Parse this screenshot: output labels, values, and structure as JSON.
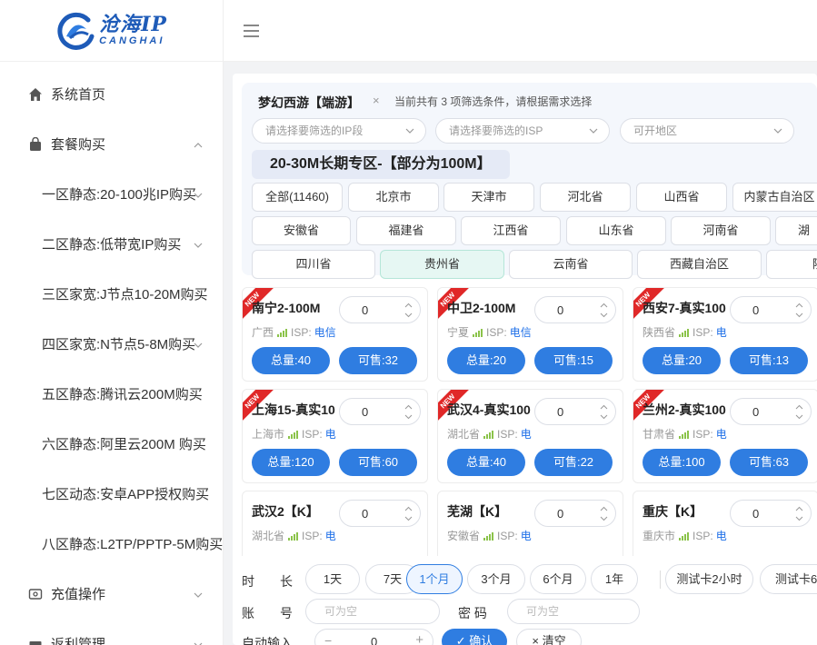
{
  "brand": {
    "name_cn": "沧海IP",
    "name_en": "CANGHAI"
  },
  "sidebar": {
    "items": [
      {
        "label": "系统首页",
        "icon": "home-icon"
      },
      {
        "label": "套餐购买",
        "icon": "bag-icon",
        "expanded": true
      },
      {
        "label": "充值操作",
        "icon": "wallet-icon"
      },
      {
        "label": "返利管理",
        "icon": "gift-icon"
      }
    ],
    "sub_items": [
      {
        "label": "一区静态:20-100兆IP购买"
      },
      {
        "label": "二区静态:低带宽IP购买"
      },
      {
        "label": "三区家宽:J节点10-20M购买"
      },
      {
        "label": "四区家宽:N节点5-8M购买"
      },
      {
        "label": "五区静态:腾讯云200M购买"
      },
      {
        "label": "六区静态:阿里云200M 购买"
      },
      {
        "label": "七区动态:安卓APP授权购买"
      },
      {
        "label": "八区静态:L2TP/PPTP-5M购买"
      }
    ]
  },
  "filter": {
    "tag": "梦幻西游【端游】",
    "close": "×",
    "hint": "当前共有 3 项筛选条件，请根据需求选择",
    "selects": [
      {
        "placeholder": "请选择要筛选的IP段"
      },
      {
        "placeholder": "请选择要筛选的ISP"
      },
      {
        "placeholder": "可开地区"
      }
    ],
    "zone_title": "20-30M长期专区-【部分为100M】",
    "regions": [
      [
        "全部(11460)",
        "北京市",
        "天津市",
        "河北省",
        "山西省",
        "内蒙古自治区"
      ],
      [
        "安徽省",
        "福建省",
        "江西省",
        "山东省",
        "河南省",
        "湖"
      ],
      [
        "四川省",
        "贵州省",
        "云南省",
        "西藏自治区",
        "陕"
      ]
    ],
    "active_region": "贵州省"
  },
  "cards": [
    {
      "name": "南宁2-100M",
      "qty": "0",
      "province": "广西",
      "isp_label": "ISP:",
      "isp": "电信",
      "total": "总量:40",
      "sell": "可售:32",
      "new": "NEW"
    },
    {
      "name": "中卫2-100M",
      "qty": "0",
      "province": "宁夏",
      "isp_label": "ISP:",
      "isp": "电信",
      "total": "总量:20",
      "sell": "可售:15",
      "new": "NEW"
    },
    {
      "name": "西安7-真实100",
      "qty": "0",
      "province": "陕西省",
      "isp_label": "ISP:",
      "isp": "电",
      "total": "总量:20",
      "sell": "可售:13",
      "new": "NEW"
    },
    {
      "name": "上海15-真实10",
      "qty": "0",
      "province": "上海市",
      "isp_label": "ISP:",
      "isp": "电",
      "total": "总量:120",
      "sell": "可售:60",
      "new": "NEW"
    },
    {
      "name": "武汉4-真实100",
      "qty": "0",
      "province": "湖北省",
      "isp_label": "ISP:",
      "isp": "电",
      "total": "总量:40",
      "sell": "可售:22",
      "new": "NEW"
    },
    {
      "name": "兰州2-真实100",
      "qty": "0",
      "province": "甘肃省",
      "isp_label": "ISP:",
      "isp": "电",
      "total": "总量:100",
      "sell": "可售:63",
      "new": "NEW"
    },
    {
      "name": "武汉2【K】",
      "qty": "0",
      "province": "湖北省",
      "isp_label": "ISP:",
      "isp": "电",
      "total": "",
      "sell": "",
      "new": ""
    },
    {
      "name": "芜湖【K】",
      "qty": "0",
      "province": "安徽省",
      "isp_label": "ISP:",
      "isp": "电",
      "total": "",
      "sell": "",
      "new": ""
    },
    {
      "name": "重庆【K】",
      "qty": "0",
      "province": "重庆市",
      "isp_label": "ISP:",
      "isp": "电",
      "total": "",
      "sell": "",
      "new": ""
    }
  ],
  "form": {
    "duration_label": "时　　长",
    "durations": [
      "1天",
      "7天",
      "1个月",
      "3个月",
      "6个月",
      "1年",
      "测试卡2小时",
      "测试卡6小"
    ],
    "active_duration": "1个月",
    "account_label": "账　　号",
    "account_placeholder": "可为空",
    "password_label": "密 码",
    "password_placeholder": "可为空",
    "auto_label": "自动输入",
    "qty_minus": "−",
    "qty_value": "0",
    "qty_plus": "+",
    "confirm": "确认",
    "clear": "清空"
  },
  "colors": {
    "primary": "#2f7de1",
    "ribbon": "#e02828",
    "brand": "#1e5bb8"
  }
}
